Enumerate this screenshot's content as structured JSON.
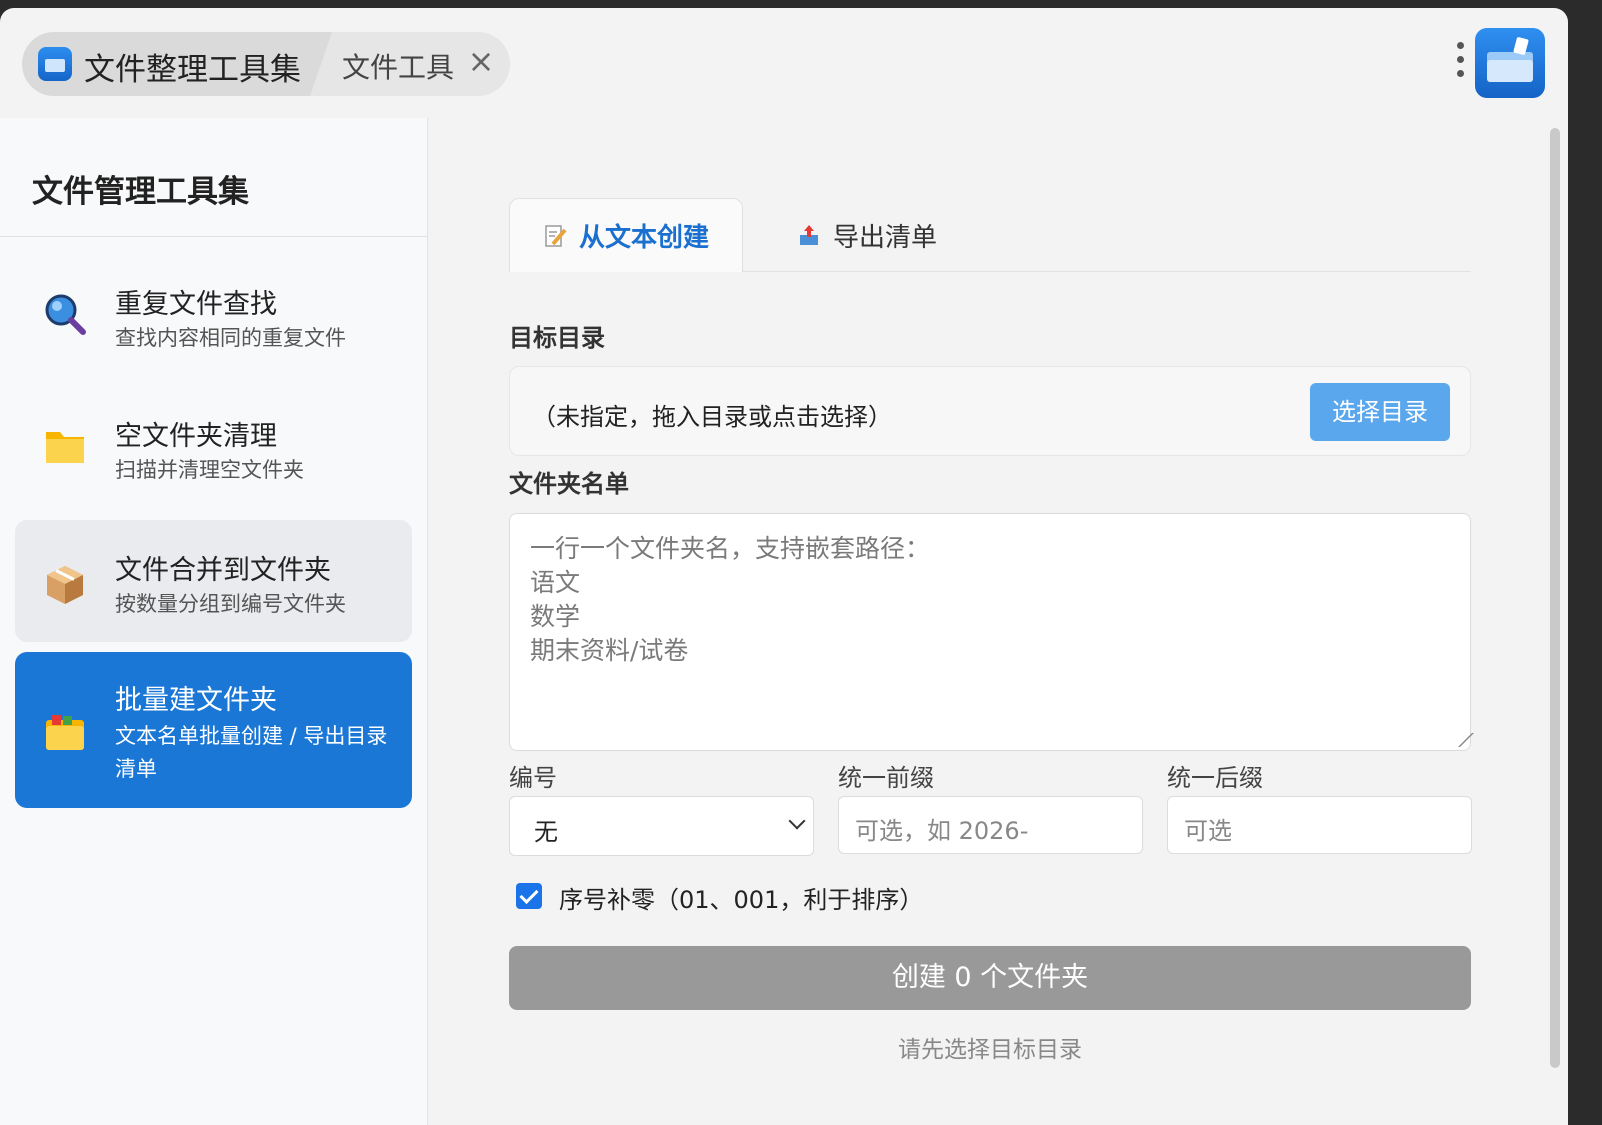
{
  "titlebar": {
    "app_title": "文件整理工具集",
    "second_tab": "文件工具"
  },
  "sidebar": {
    "title": "文件管理工具集",
    "items": [
      {
        "label": "重复文件查找",
        "desc": "查找内容相同的重复文件",
        "icon": "magnifier-icon"
      },
      {
        "label": "空文件夹清理",
        "desc": "扫描并清理空文件夹",
        "icon": "folder-icon"
      },
      {
        "label": "文件合并到文件夹",
        "desc": "按数量分组到编号文件夹",
        "icon": "package-icon"
      },
      {
        "label": "批量建文件夹",
        "desc": "文本名单批量创建 / 导出目录清单",
        "icon": "card-folder-icon"
      }
    ],
    "active_index": 3
  },
  "main": {
    "tabs": [
      {
        "label": "从文本创建",
        "active": true
      },
      {
        "label": "导出清单",
        "active": false
      }
    ],
    "target_dir_label": "目标目录",
    "target_dir_text": "（未指定，拖入目录或点击选择）",
    "choose_dir_button": "选择目录",
    "folder_list_label": "文件夹名单",
    "folder_list_placeholder": "一行一个文件夹名，支持嵌套路径：\n语文\n数学\n期末资料/试卷",
    "numbering_label": "编号",
    "numbering_value": "无",
    "prefix_label": "统一前缀",
    "prefix_placeholder": "可选，如 2026-",
    "suffix_label": "统一后缀",
    "suffix_placeholder": "可选",
    "zero_pad_label": "序号补零（01、001，利于排序）",
    "zero_pad_checked": true,
    "create_button": "创建 0 个文件夹",
    "hint": "请先选择目标目录"
  },
  "colors": {
    "accent": "#1a77d6",
    "choose_button": "#5aa7ee",
    "create_button_disabled": "#999999"
  }
}
